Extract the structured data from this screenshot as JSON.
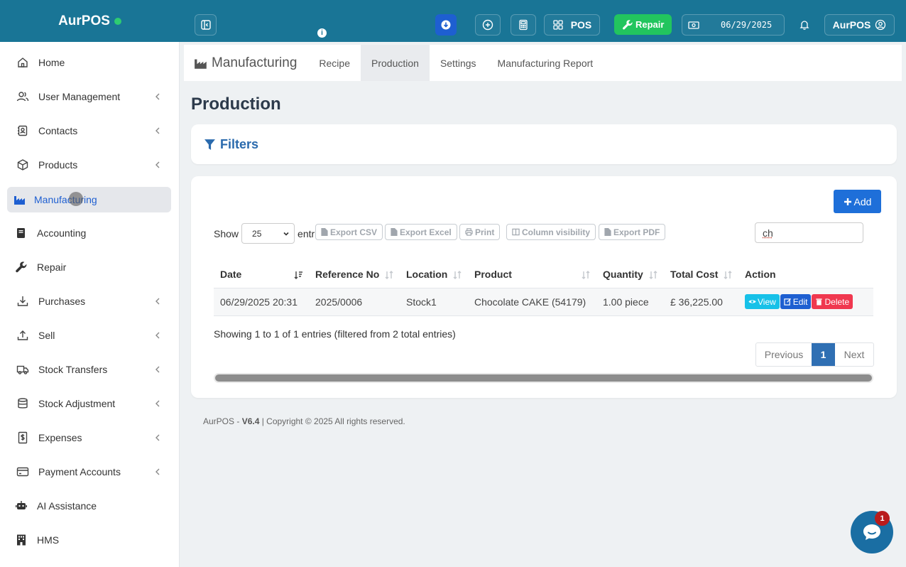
{
  "header": {
    "brand": "AurPOS",
    "pos_label": "POS",
    "repair_label": "Repair",
    "date": "06/29/2025",
    "user": "AurPOS",
    "info_glyph": "i"
  },
  "sidebar": {
    "items": [
      {
        "label": "Home",
        "icon": "home-icon"
      },
      {
        "label": "User Management",
        "icon": "users-icon"
      },
      {
        "label": "Contacts",
        "icon": "address-book-icon"
      },
      {
        "label": "Products",
        "icon": "cube-icon"
      },
      {
        "label": "Manufacturing",
        "icon": "industry-icon"
      },
      {
        "label": "Accounting",
        "icon": "book-icon"
      },
      {
        "label": "Repair",
        "icon": "wrench-icon"
      },
      {
        "label": "Purchases",
        "icon": "download-icon"
      },
      {
        "label": "Sell",
        "icon": "upload-icon"
      },
      {
        "label": "Stock Transfers",
        "icon": "truck-icon"
      },
      {
        "label": "Stock Adjustment",
        "icon": "database-icon"
      },
      {
        "label": "Expenses",
        "icon": "dollar-file-icon"
      },
      {
        "label": "Payment Accounts",
        "icon": "credit-card-icon"
      },
      {
        "label": "AI Assistance",
        "icon": "robot-icon"
      },
      {
        "label": "HMS",
        "icon": "hotel-icon"
      }
    ]
  },
  "subnav": {
    "title": "Manufacturing",
    "tabs": [
      "Recipe",
      "Production",
      "Settings",
      "Manufacturing Report"
    ]
  },
  "page": {
    "title": "Production",
    "filters_label": "Filters",
    "add_label": "Add"
  },
  "table_controls": {
    "show_label": "Show",
    "page_length": "25",
    "entries_label": "entri",
    "search_value": "ch",
    "export_buttons": [
      "Export CSV",
      "Export Excel",
      "Print",
      "Column visibility",
      "Export PDF"
    ]
  },
  "table": {
    "columns": [
      "Date",
      "Reference No",
      "Location",
      "Product",
      "Quantity",
      "Total Cost",
      "Action"
    ],
    "rows": [
      {
        "date": "06/29/2025 20:31",
        "ref": "2025/0006",
        "location": "Stock1",
        "product": "Chocolate CAKE (54179)",
        "quantity": "1.00 piece",
        "total_cost": "£ 36,225.00"
      }
    ],
    "actions": {
      "view": "View",
      "edit": "Edit",
      "delete": "Delete"
    },
    "info": "Showing 1 to 1 of 1 entries (filtered from 2 total entries)",
    "pager": {
      "previous": "Previous",
      "current": "1",
      "next": "Next"
    }
  },
  "footer": {
    "brand": "AurPOS - ",
    "version": "V6.4",
    "copyright": " | Copyright © 2025 All rights reserved."
  },
  "chat": {
    "badge": "1"
  },
  "colors": {
    "topbar": "#197596",
    "accent": "#1e6fd9",
    "repair": "#22c55e",
    "view": "#17c1e8",
    "edit": "#1e5fd1",
    "delete": "#f0384f"
  }
}
